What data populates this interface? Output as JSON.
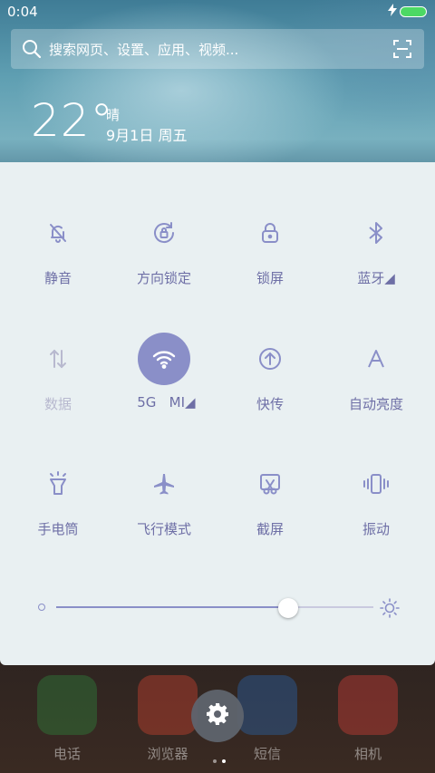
{
  "status_bar": {
    "time": "0:04",
    "charging_icon": "bolt-icon",
    "battery_color": "#4cd964"
  },
  "search": {
    "placeholder": "搜索网页、设置、应用、视频..."
  },
  "weather": {
    "temperature": "22°",
    "condition": "晴",
    "date": "9月1日 周五"
  },
  "quick_settings": {
    "row1": [
      {
        "label": "静音",
        "icon": "bell-off-icon"
      },
      {
        "label": "方向锁定",
        "icon": "rotation-lock-icon"
      },
      {
        "label": "锁屏",
        "icon": "lock-icon"
      },
      {
        "label": "蓝牙◢",
        "icon": "bluetooth-icon"
      }
    ],
    "row2": [
      {
        "label": "数据",
        "icon": "data-arrows-icon",
        "state": "off"
      },
      {
        "label": " 5G   MI◢",
        "icon": "wifi-icon",
        "state": "on"
      },
      {
        "label": "快传",
        "icon": "upload-circle-icon"
      },
      {
        "label": "自动亮度",
        "icon": "auto-brightness-icon"
      }
    ],
    "row3": [
      {
        "label": "手电筒",
        "icon": "flashlight-icon"
      },
      {
        "label": "飞行模式",
        "icon": "airplane-icon"
      },
      {
        "label": "截屏",
        "icon": "screenshot-icon"
      },
      {
        "label": "振动",
        "icon": "vibrate-icon"
      }
    ],
    "accent_color": "#8a8fc8",
    "label_color": "#6e6fa6"
  },
  "brightness": {
    "level": 0.73
  },
  "dock": {
    "apps": [
      {
        "label": "电话",
        "icon": "phone-icon",
        "color": "#2e7d3a"
      },
      {
        "label": "浏览器",
        "icon": "globe-icon",
        "color": "#c2412f"
      },
      {
        "label": "短信",
        "icon": "message-icon",
        "color": "#2b5fa0"
      },
      {
        "label": "相机",
        "icon": "camera-icon",
        "color": "#c63b36"
      }
    ]
  },
  "settings_fab": {
    "icon": "gear-icon"
  },
  "page_indicator": {
    "count": 2,
    "active": 1
  }
}
